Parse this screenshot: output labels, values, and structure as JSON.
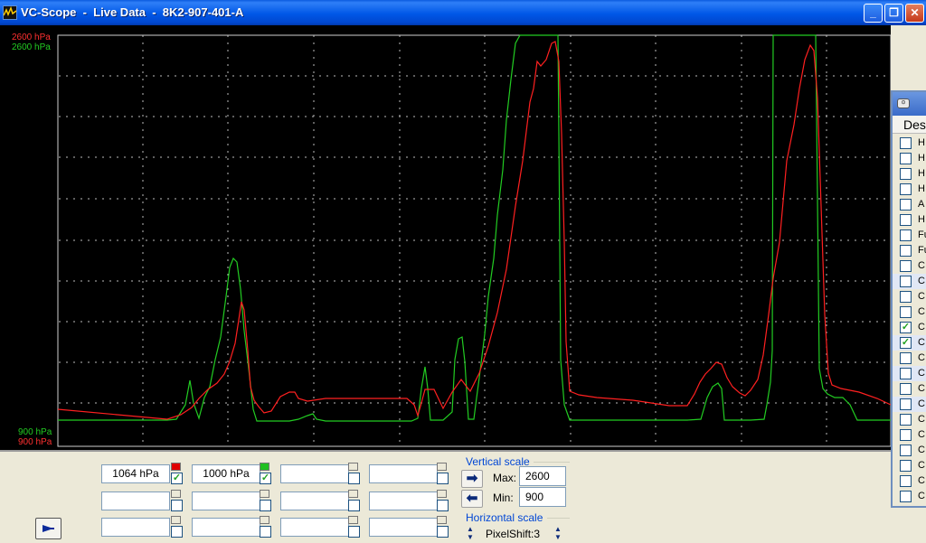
{
  "window": {
    "title": "VC-Scope  -  Live Data  -  8K2-907-401-A",
    "minimize": "_",
    "maximize": "❐",
    "close": "✕"
  },
  "scope": {
    "top_red": "2600 hPa",
    "top_green": "2600 hPa",
    "bottom_green": "900 hPa",
    "bottom_red": "900 hPa"
  },
  "colors": {
    "red": "#ff2020",
    "green": "#22cc22",
    "grid": "#bbbbbb",
    "background": "#000000"
  },
  "channels": {
    "ch1": {
      "value": "1064 hPa",
      "color": "#e00000",
      "checked": true
    },
    "ch2": {
      "value": "1000 hPa",
      "color": "#20c020",
      "checked": true
    }
  },
  "vertical_scale": {
    "label": "Vertical scale",
    "max_label": "Max:",
    "max_value": "2600",
    "min_label": "Min:",
    "min_value": "900"
  },
  "horizontal_scale": {
    "label": "Horizontal scale",
    "value": "PixelShift:3"
  },
  "panel": {
    "header": "Des",
    "rows": [
      {
        "label": "H",
        "checked": false,
        "alt": false
      },
      {
        "label": "H",
        "checked": false,
        "alt": false
      },
      {
        "label": "H",
        "checked": false,
        "alt": false
      },
      {
        "label": "H",
        "checked": false,
        "alt": false
      },
      {
        "label": "A",
        "checked": false,
        "alt": false
      },
      {
        "label": "H",
        "checked": false,
        "alt": false
      },
      {
        "label": "Fu",
        "checked": false,
        "alt": false
      },
      {
        "label": "Fu",
        "checked": false,
        "alt": false
      },
      {
        "label": "C",
        "checked": false,
        "alt": false
      },
      {
        "label": "C",
        "checked": false,
        "alt": true
      },
      {
        "label": "C",
        "checked": false,
        "alt": false
      },
      {
        "label": "C",
        "checked": false,
        "alt": false
      },
      {
        "label": "C",
        "checked": true,
        "alt": false
      },
      {
        "label": "C",
        "checked": true,
        "alt": true
      },
      {
        "label": "C",
        "checked": false,
        "alt": false
      },
      {
        "label": "C",
        "checked": false,
        "alt": true
      },
      {
        "label": "C",
        "checked": false,
        "alt": false
      },
      {
        "label": "C",
        "checked": false,
        "alt": true
      },
      {
        "label": "C",
        "checked": false,
        "alt": false
      },
      {
        "label": "C",
        "checked": false,
        "alt": false
      },
      {
        "label": "C",
        "checked": false,
        "alt": false
      },
      {
        "label": "C",
        "checked": false,
        "alt": false
      },
      {
        "label": "C",
        "checked": false,
        "alt": false
      },
      {
        "label": "C",
        "checked": false,
        "alt": false
      }
    ]
  }
}
